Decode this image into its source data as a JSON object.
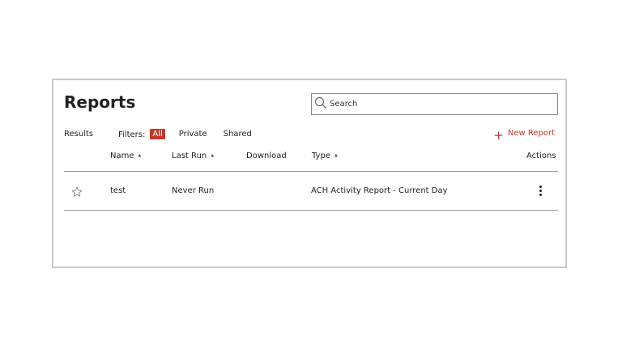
{
  "page": {
    "title": "Reports"
  },
  "search": {
    "placeholder": "Search",
    "value": ""
  },
  "toolbar": {
    "results_label": "Results",
    "filters_label": "Filters:",
    "filters": [
      {
        "label": "All",
        "active": true
      },
      {
        "label": "Private",
        "active": false
      },
      {
        "label": "Shared",
        "active": false
      }
    ],
    "new_report_label": "New Report"
  },
  "table": {
    "columns": [
      "Name",
      "Last Run",
      "Download",
      "Type",
      "Actions"
    ],
    "sortable_columns": [
      "Name",
      "Last Run",
      "Type"
    ],
    "rows": [
      {
        "name": "test",
        "last_run": "Never Run",
        "download": "",
        "type": "ACH Activity Report - Current Day",
        "favorite": false
      }
    ]
  },
  "colors": {
    "accent": "#c0392b",
    "border": "#c9c9c9",
    "rule": "#9a9a9a"
  },
  "icons": {
    "search": "search-icon",
    "star": "star-outline-icon",
    "actions": "kebab-menu-icon",
    "add": "plus-icon"
  }
}
